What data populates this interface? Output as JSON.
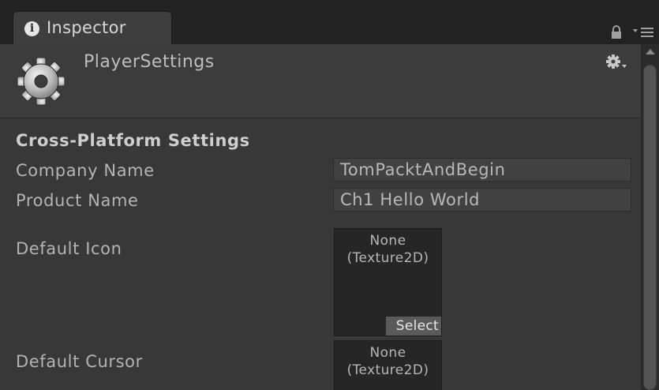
{
  "tab": {
    "label": "Inspector",
    "icon": "info-icon",
    "icon_glyph": "i"
  },
  "toolbar": {
    "lock_icon": "lock-icon",
    "menu_icon": "menu-icon"
  },
  "header": {
    "title": "PlayerSettings",
    "icon": "gear-icon",
    "settings_icon": "settings-gear-icon"
  },
  "section": {
    "title": "Cross-Platform Settings"
  },
  "fields": {
    "company_name": {
      "label": "Company Name",
      "value": "TomPacktAndBegin"
    },
    "product_name": {
      "label": "Product Name",
      "value": "Ch1 Hello World"
    },
    "default_icon": {
      "label": "Default Icon",
      "line1": "None",
      "line2": "(Texture2D)",
      "select_label": "Select"
    },
    "default_cursor": {
      "label": "Default Cursor",
      "line1": "None",
      "line2": "(Texture2D)"
    }
  },
  "colors": {
    "background": "#383838",
    "tab_strip": "#222222",
    "field_bg": "#414141",
    "object_field_bg": "#262626"
  }
}
